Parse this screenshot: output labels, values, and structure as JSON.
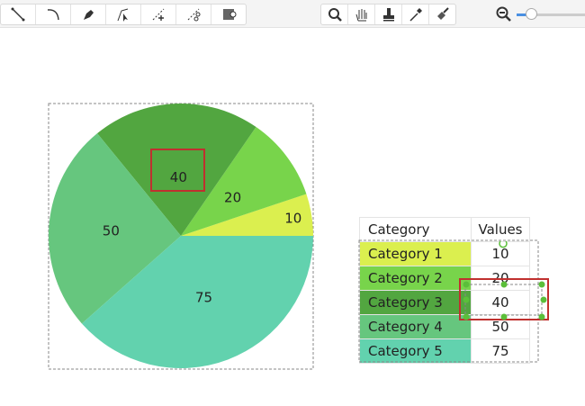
{
  "toolbar": {
    "drawing_tools": [
      "line-icon",
      "arc-icon",
      "pen-icon",
      "select-point-icon",
      "add-point-icon",
      "scissors-icon",
      "insert-image-icon"
    ],
    "view_tools": [
      "magnifier-icon",
      "hand-icon",
      "stamp-icon",
      "eyedropper-icon",
      "paintbrush-icon"
    ],
    "zoom_level": 0.2
  },
  "chart_data": {
    "type": "pie",
    "categories": [
      "Category 1",
      "Category 2",
      "Category 3",
      "Category 4",
      "Category 5"
    ],
    "values": [
      10,
      20,
      40,
      50,
      75
    ],
    "colors": [
      "#dbef4f",
      "#78d44b",
      "#52a640",
      "#66c67e",
      "#62d2ae"
    ],
    "labels": [
      "10",
      "20",
      "40",
      "50",
      "75"
    ],
    "selected": "Category 3"
  },
  "table": {
    "header": {
      "category": "Category",
      "values": "Values"
    },
    "rows": [
      {
        "category": "Category 1",
        "value": "10"
      },
      {
        "category": "Category 2",
        "value": "20"
      },
      {
        "category": "Category 3",
        "value": "40"
      },
      {
        "category": "Category 4",
        "value": "50"
      },
      {
        "category": "Category 5",
        "value": "75"
      }
    ]
  },
  "colors": {
    "selection": "#c0302f",
    "handle": "#5bbf3a"
  }
}
